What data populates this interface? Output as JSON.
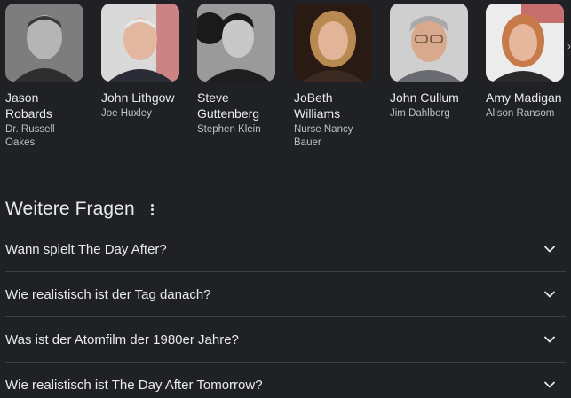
{
  "cast": [
    {
      "name": "Jason Robards",
      "role": "Dr. Russell Oakes",
      "photo_icon": "portrait-photo"
    },
    {
      "name": "John Lithgow",
      "role": "Joe Huxley",
      "photo_icon": "portrait-photo"
    },
    {
      "name": "Steve Guttenberg",
      "role": "Stephen Klein",
      "photo_icon": "portrait-photo"
    },
    {
      "name": "JoBeth Williams",
      "role": "Nurse Nancy Bauer",
      "photo_icon": "portrait-photo"
    },
    {
      "name": "John Cullum",
      "role": "Jim Dahlberg",
      "photo_icon": "portrait-photo"
    },
    {
      "name": "Amy Madigan",
      "role": "Alison Ransom",
      "photo_icon": "portrait-photo"
    }
  ],
  "more_questions": {
    "title": "Weitere Fragen",
    "items": [
      {
        "question": "Wann spielt The Day After?"
      },
      {
        "question": "Wie realistisch ist der Tag danach?"
      },
      {
        "question": "Was ist der Atomfilm der 1980er Jahre?"
      },
      {
        "question": "Wie realistisch ist The Day After Tomorrow?"
      }
    ]
  },
  "colors": {
    "background": "#202124",
    "text_primary": "#e8eaed",
    "text_secondary": "#bdc1c6",
    "divider": "#3c4043"
  }
}
